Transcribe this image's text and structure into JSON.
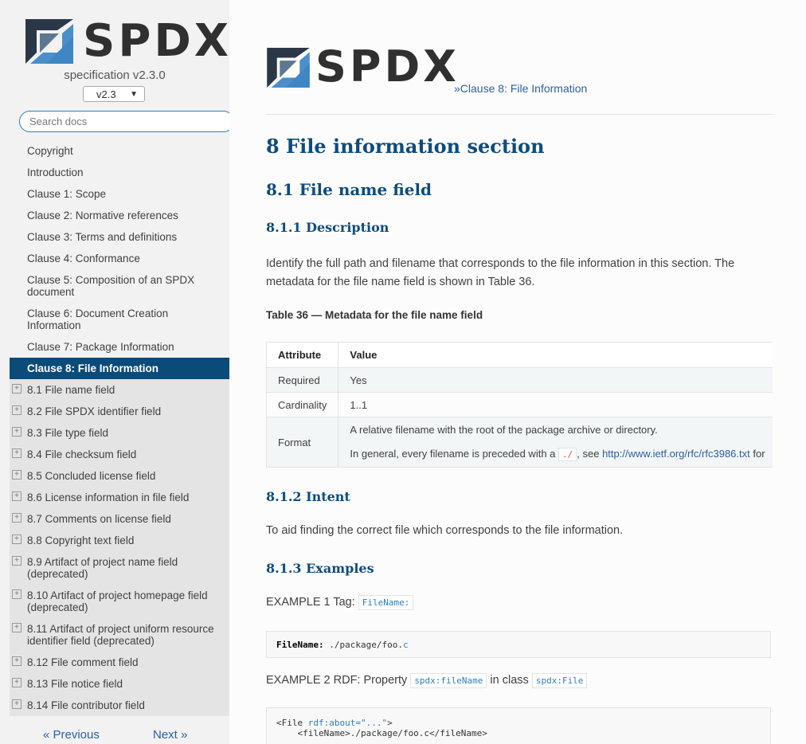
{
  "sidebar": {
    "logo_text": "SPDX",
    "spec_label": "specification v2.3.0",
    "version": "v2.3",
    "search_placeholder": "Search docs",
    "items": [
      {
        "label": "Copyright"
      },
      {
        "label": "Introduction"
      },
      {
        "label": "Clause 1: Scope"
      },
      {
        "label": "Clause 2: Normative references"
      },
      {
        "label": "Clause 3: Terms and definitions"
      },
      {
        "label": "Clause 4: Conformance"
      },
      {
        "label": "Clause 5: Composition of an SPDX document"
      },
      {
        "label": "Clause 6: Document Creation Information"
      },
      {
        "label": "Clause 7: Package Information"
      },
      {
        "label": "Clause 8: File Information"
      }
    ],
    "subitems": [
      {
        "label": "8.1 File name field"
      },
      {
        "label": "8.2 File SPDX identifier field"
      },
      {
        "label": "8.3 File type field"
      },
      {
        "label": "8.4 File checksum field"
      },
      {
        "label": "8.5 Concluded license field"
      },
      {
        "label": "8.6 License information in file field"
      },
      {
        "label": "8.7 Comments on license field"
      },
      {
        "label": "8.8 Copyright text field"
      },
      {
        "label": "8.9 Artifact of project name field (deprecated)"
      },
      {
        "label": "8.10 Artifact of project homepage field (deprecated)"
      },
      {
        "label": "8.11 Artifact of project uniform resource identifier field (deprecated)"
      },
      {
        "label": "8.12 File comment field"
      },
      {
        "label": "8.13 File notice field"
      },
      {
        "label": "8.14 File contributor field"
      }
    ],
    "prev_label": "« Previous",
    "next_label": "Next »"
  },
  "content": {
    "logo_text": "SPDX",
    "breadcrumb": "»Clause 8: File Information",
    "h1": "8 File information section",
    "h2": "8.1 File name field",
    "h3_description": "8.1.1 Description",
    "description": "Identify the full path and filename that corresponds to the file information in this section. The metadata for the file name field is shown in Table 36.",
    "table_caption": "Table 36 — Metadata for the file name field",
    "table": {
      "headers": [
        "Attribute",
        "Value"
      ],
      "rows": [
        {
          "attr": "Required",
          "value": "Yes"
        },
        {
          "attr": "Cardinality",
          "value": "1..1"
        },
        {
          "attr": "Format",
          "value_line1": "A relative filename with the root of the package archive or directory.",
          "value_line2_pre": "In general, every filename is preceded with a ",
          "value_line2_code": "./",
          "value_line2_mid": ", see ",
          "value_line2_link": "http://www.ietf.org/rfc/rfc3986.txt",
          "value_line2_post": " for"
        }
      ]
    },
    "h3_intent": "8.1.2 Intent",
    "intent": "To aid finding the correct file which corresponds to the file information.",
    "h3_examples": "8.1.3 Examples",
    "example1_pre": "EXAMPLE 1 Tag: ",
    "example1_code": "FileName:",
    "code1_key": "FileName:",
    "code1_val": " ./package/foo.",
    "code1_ext": "c",
    "example2_pre": "EXAMPLE 2 RDF: Property ",
    "example2_code1": "spdx:fileName",
    "example2_mid": " in class ",
    "example2_code2": "spdx:File",
    "code2_line1_pre": "<File ",
    "code2_line1_attr": "rdf:about=\"...\"",
    "code2_line1_post": ">",
    "code2_line2": "    <fileName>./package/foo.c</fileName>",
    "code2_line3": "    ..."
  }
}
